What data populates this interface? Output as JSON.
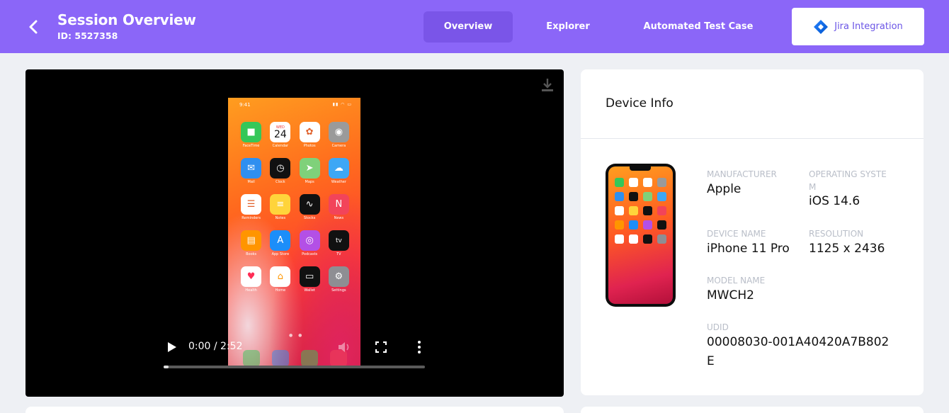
{
  "header": {
    "title": "Session Overview",
    "session_id": "ID: 5527358",
    "tabs": [
      {
        "label": "Overview"
      },
      {
        "label": "Explorer"
      },
      {
        "label": "Automated Test Case"
      }
    ],
    "jira_label": "Jira Integration"
  },
  "video": {
    "time": "0:00 / 2:52",
    "progress": 0.02,
    "phone": {
      "clock": "9:41",
      "calendar_day": "WED",
      "calendar_date": "24",
      "apps": [
        {
          "label": "FaceTime",
          "color": "#35c759",
          "glyph": "■"
        },
        {
          "label": "Calendar",
          "color": "#ffffff",
          "glyph": ""
        },
        {
          "label": "Photos",
          "color": "#ffffff",
          "glyph": "✿"
        },
        {
          "label": "Camera",
          "color": "#9a9a9a",
          "glyph": "◉"
        },
        {
          "label": "Mail",
          "color": "#2f8ff0",
          "glyph": "✉"
        },
        {
          "label": "Clock",
          "color": "#111111",
          "glyph": "◷"
        },
        {
          "label": "Maps",
          "color": "#7fd17a",
          "glyph": "➤"
        },
        {
          "label": "Weather",
          "color": "#3da7f5",
          "glyph": "☁"
        },
        {
          "label": "Reminders",
          "color": "#ffffff",
          "glyph": "☰"
        },
        {
          "label": "Notes",
          "color": "#ffd43b",
          "glyph": "≡"
        },
        {
          "label": "Stocks",
          "color": "#111111",
          "glyph": "∿"
        },
        {
          "label": "News",
          "color": "#f2445a",
          "glyph": "N"
        },
        {
          "label": "Books",
          "color": "#ff9500",
          "glyph": "▤"
        },
        {
          "label": "App Store",
          "color": "#1c8ef9",
          "glyph": "A"
        },
        {
          "label": "Podcasts",
          "color": "#b350e6",
          "glyph": "◎"
        },
        {
          "label": "TV",
          "color": "#111111",
          "glyph": "tv"
        },
        {
          "label": "Health",
          "color": "#ffffff",
          "glyph": "♥"
        },
        {
          "label": "Home",
          "color": "#ffffff",
          "glyph": "⌂"
        },
        {
          "label": "Wallet",
          "color": "#111111",
          "glyph": "▭"
        },
        {
          "label": "Settings",
          "color": "#8e8e93",
          "glyph": "⚙"
        }
      ]
    }
  },
  "device_info": {
    "title": "Device Info",
    "manufacturer_label": "MANUFACTURER",
    "manufacturer": "Apple",
    "os_label": "OPERATING SYSTE M",
    "os": "iOS 14.6",
    "device_name_label": "DEVICE NAME",
    "device_name": "iPhone 11 Pro",
    "resolution_label": "RESOLUTION",
    "resolution": "1125 x 2436",
    "model_label": "MODEL NAME",
    "model": "MWCH2",
    "udid_label": "UDID",
    "udid": "00008030-001A40420A7B802E"
  },
  "colors": {
    "header": "#8b66f8",
    "active_tab": "#7a55e8",
    "jira_text": "#6b55e6",
    "page_bg": "#eef0f4"
  }
}
